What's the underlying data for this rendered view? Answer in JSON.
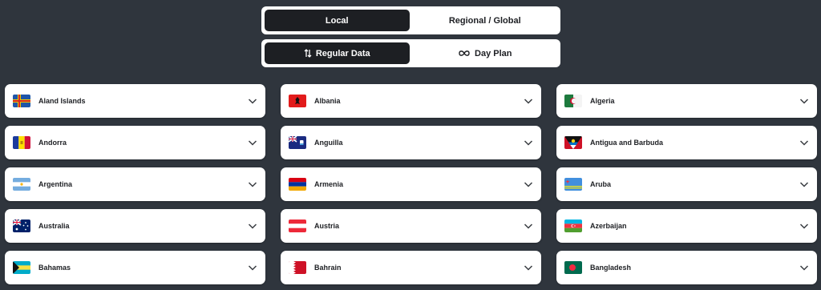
{
  "scope_toggle": {
    "local_label": "Local",
    "regional_label": "Regional / Global"
  },
  "plan_toggle": {
    "regular_label": "Regular Data",
    "day_label": "Day Plan"
  },
  "countries": [
    {
      "name": "Aland Islands",
      "flag": "aland-islands-flag-icon"
    },
    {
      "name": "Albania",
      "flag": "albania-flag-icon"
    },
    {
      "name": "Algeria",
      "flag": "algeria-flag-icon"
    },
    {
      "name": "Andorra",
      "flag": "andorra-flag-icon"
    },
    {
      "name": "Anguilla",
      "flag": "anguilla-flag-icon"
    },
    {
      "name": "Antigua and Barbuda",
      "flag": "antigua-and-barbuda-flag-icon"
    },
    {
      "name": "Argentina",
      "flag": "argentina-flag-icon"
    },
    {
      "name": "Armenia",
      "flag": "armenia-flag-icon"
    },
    {
      "name": "Aruba",
      "flag": "aruba-flag-icon"
    },
    {
      "name": "Australia",
      "flag": "australia-flag-icon"
    },
    {
      "name": "Austria",
      "flag": "austria-flag-icon"
    },
    {
      "name": "Azerbaijan",
      "flag": "azerbaijan-flag-icon"
    },
    {
      "name": "Bahamas",
      "flag": "bahamas-flag-icon"
    },
    {
      "name": "Bahrain",
      "flag": "bahrain-flag-icon"
    },
    {
      "name": "Bangladesh",
      "flag": "bangladesh-flag-icon"
    }
  ],
  "colors": {
    "background": "#2f353d",
    "active_toggle": "#1d1f23",
    "card": "#ffffff"
  }
}
